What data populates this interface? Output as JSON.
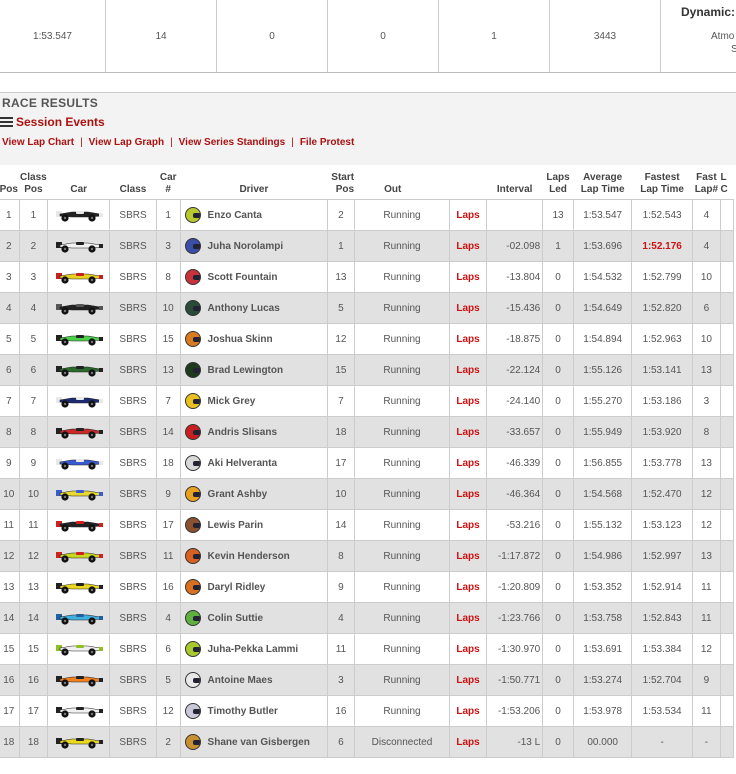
{
  "summary": {
    "cells": [
      "1:53.547",
      "14",
      "0",
      "0",
      "1",
      "3443"
    ],
    "dynamic_label": "Dynamic:",
    "atmo_label": "Atmo",
    "atmo_tail": "S"
  },
  "header": {
    "title": "RACE RESULTS",
    "session_events": "Session Events",
    "links": [
      "View Lap Chart",
      "View Lap Graph",
      "View Series Standings",
      "File Protest"
    ],
    "link_sep": "|"
  },
  "table": {
    "columns": {
      "pos": "Pos",
      "class_pos_1": "Class",
      "class_pos_2": "Pos",
      "car": "Car",
      "class": "Class",
      "car_num_1": "Car",
      "car_num_2": "#",
      "driver": "Driver",
      "start_1": "Start",
      "start_2": "Pos",
      "out": "Out",
      "interval": "Interval",
      "laps_led_1": "Laps",
      "laps_led_2": "Led",
      "avg_1": "Average",
      "avg_2": "Lap Time",
      "fast_1": "Fastest",
      "fast_2": "Lap Time",
      "fastlap_1": "Fast",
      "fastlap_2": "Lap#",
      "extra_1": "L",
      "extra_2": "C"
    },
    "laps_label": "Laps",
    "rows": [
      {
        "pos": "1",
        "class_pos": "1",
        "class": "SBRS",
        "car_num": "1",
        "driver": "Enzo Canta",
        "start": "2",
        "out": "Running",
        "interval": "",
        "laps_led": "13",
        "avg": "1:53.547",
        "fastest": "1:52.543",
        "fast_lap": "4",
        "car_color": "#222222",
        "car_accent": "#e8e8e8",
        "helmet": "#b8c830",
        "best": false
      },
      {
        "pos": "2",
        "class_pos": "2",
        "class": "SBRS",
        "car_num": "3",
        "driver": "Juha Norolampi",
        "start": "1",
        "out": "Running",
        "interval": "-02.098",
        "laps_led": "1",
        "avg": "1:53.696",
        "fastest": "1:52.176",
        "fast_lap": "4",
        "car_color": "#f2f2f2",
        "car_accent": "#222222",
        "helmet": "#3a4ea8",
        "best": true
      },
      {
        "pos": "3",
        "class_pos": "3",
        "class": "SBRS",
        "car_num": "8",
        "driver": "Scott Fountain",
        "start": "13",
        "out": "Running",
        "interval": "-13.804",
        "laps_led": "0",
        "avg": "1:54.532",
        "fastest": "1:52.799",
        "fast_lap": "10",
        "car_color": "#e8d020",
        "car_accent": "#c82020",
        "helmet": "#c8323a",
        "best": false
      },
      {
        "pos": "4",
        "class_pos": "4",
        "class": "SBRS",
        "car_num": "10",
        "driver": "Anthony Lucas",
        "start": "5",
        "out": "Running",
        "interval": "-15.436",
        "laps_led": "0",
        "avg": "1:54.649",
        "fastest": "1:52.820",
        "fast_lap": "6",
        "car_color": "#222222",
        "car_accent": "#555555",
        "helmet": "#2a4a3a",
        "best": false
      },
      {
        "pos": "5",
        "class_pos": "5",
        "class": "SBRS",
        "car_num": "15",
        "driver": "Joshua Skinn",
        "start": "12",
        "out": "Running",
        "interval": "-18.875",
        "laps_led": "0",
        "avg": "1:54.894",
        "fastest": "1:52.963",
        "fast_lap": "10",
        "car_color": "#4ad04a",
        "car_accent": "#222222",
        "helmet": "#d87a20",
        "best": false
      },
      {
        "pos": "6",
        "class_pos": "6",
        "class": "SBRS",
        "car_num": "13",
        "driver": "Brad Lewington",
        "start": "15",
        "out": "Running",
        "interval": "-22.124",
        "laps_led": "0",
        "avg": "1:55.126",
        "fastest": "1:53.141",
        "fast_lap": "13",
        "car_color": "#2a6a2a",
        "car_accent": "#222222",
        "helmet": "#1e3a1e",
        "best": false
      },
      {
        "pos": "7",
        "class_pos": "7",
        "class": "SBRS",
        "car_num": "7",
        "driver": "Mick Grey",
        "start": "7",
        "out": "Running",
        "interval": "-24.140",
        "laps_led": "0",
        "avg": "1:55.270",
        "fastest": "1:53.186",
        "fast_lap": "3",
        "car_color": "#1e2a70",
        "car_accent": "#e8e8e8",
        "helmet": "#e8c020",
        "best": false
      },
      {
        "pos": "8",
        "class_pos": "8",
        "class": "SBRS",
        "car_num": "14",
        "driver": "Andris Slisans",
        "start": "18",
        "out": "Running",
        "interval": "-33.657",
        "laps_led": "0",
        "avg": "1:55.949",
        "fastest": "1:53.920",
        "fast_lap": "8",
        "car_color": "#c82a2a",
        "car_accent": "#222222",
        "helmet": "#c82020",
        "best": false
      },
      {
        "pos": "9",
        "class_pos": "9",
        "class": "SBRS",
        "car_num": "18",
        "driver": "Aki Helveranta",
        "start": "17",
        "out": "Running",
        "interval": "-46.339",
        "laps_led": "0",
        "avg": "1:56.855",
        "fastest": "1:53.778",
        "fast_lap": "13",
        "car_color": "#3a5ad0",
        "car_accent": "#e8e8e8",
        "helmet": "#d8d8d8",
        "best": false
      },
      {
        "pos": "10",
        "class_pos": "10",
        "class": "SBRS",
        "car_num": "9",
        "driver": "Grant Ashby",
        "start": "10",
        "out": "Running",
        "interval": "-46.364",
        "laps_led": "0",
        "avg": "1:54.568",
        "fastest": "1:52.470",
        "fast_lap": "12",
        "car_color": "#e8d830",
        "car_accent": "#3a5ad0",
        "helmet": "#e8a020",
        "best": false
      },
      {
        "pos": "11",
        "class_pos": "11",
        "class": "SBRS",
        "car_num": "17",
        "driver": "Lewis Parin",
        "start": "14",
        "out": "Running",
        "interval": "-53.216",
        "laps_led": "0",
        "avg": "1:55.132",
        "fastest": "1:53.123",
        "fast_lap": "12",
        "car_color": "#222222",
        "car_accent": "#d02020",
        "helmet": "#8a5030",
        "best": false
      },
      {
        "pos": "12",
        "class_pos": "12",
        "class": "SBRS",
        "car_num": "11",
        "driver": "Kevin Henderson",
        "start": "8",
        "out": "Running",
        "interval": "-1:17.872",
        "laps_led": "0",
        "avg": "1:54.986",
        "fastest": "1:52.997",
        "fast_lap": "13",
        "car_color": "#c8d820",
        "car_accent": "#d02020",
        "helmet": "#d86020",
        "best": false
      },
      {
        "pos": "13",
        "class_pos": "13",
        "class": "SBRS",
        "car_num": "16",
        "driver": "Daryl Ridley",
        "start": "9",
        "out": "Running",
        "interval": "-1:20.809",
        "laps_led": "0",
        "avg": "1:53.352",
        "fastest": "1:52.914",
        "fast_lap": "11",
        "car_color": "#e8d820",
        "car_accent": "#222222",
        "helmet": "#d87020",
        "best": false
      },
      {
        "pos": "14",
        "class_pos": "14",
        "class": "SBRS",
        "car_num": "4",
        "driver": "Colin Suttie",
        "start": "4",
        "out": "Running",
        "interval": "-1:23.766",
        "laps_led": "0",
        "avg": "1:53.758",
        "fastest": "1:52.843",
        "fast_lap": "11",
        "car_color": "#40b0e0",
        "car_accent": "#2060a0",
        "helmet": "#60b040",
        "best": false
      },
      {
        "pos": "15",
        "class_pos": "15",
        "class": "SBRS",
        "car_num": "6",
        "driver": "Juha-Pekka Lammi",
        "start": "11",
        "out": "Running",
        "interval": "-1:30.970",
        "laps_led": "0",
        "avg": "1:53.691",
        "fastest": "1:53.384",
        "fast_lap": "12",
        "car_color": "#f0f0f0",
        "car_accent": "#90c020",
        "helmet": "#a8c830",
        "best": false
      },
      {
        "pos": "16",
        "class_pos": "16",
        "class": "SBRS",
        "car_num": "5",
        "driver": "Antoine Maes",
        "start": "3",
        "out": "Running",
        "interval": "-1:50.771",
        "laps_led": "0",
        "avg": "1:53.274",
        "fastest": "1:52.704",
        "fast_lap": "9",
        "car_color": "#f08020",
        "car_accent": "#222222",
        "helmet": "#e8e8e8",
        "best": false
      },
      {
        "pos": "17",
        "class_pos": "17",
        "class": "SBRS",
        "car_num": "12",
        "driver": "Timothy Butler",
        "start": "16",
        "out": "Running",
        "interval": "-1:53.206",
        "laps_led": "0",
        "avg": "1:53.978",
        "fastest": "1:53.534",
        "fast_lap": "11",
        "car_color": "#f0f0f0",
        "car_accent": "#222222",
        "helmet": "#c8c8d8",
        "best": false
      },
      {
        "pos": "18",
        "class_pos": "18",
        "class": "SBRS",
        "car_num": "2",
        "driver": "Shane van Gisbergen",
        "start": "6",
        "out": "Disconnected",
        "interval": "-13 L",
        "laps_led": "0",
        "avg": "00.000",
        "fastest": "-",
        "fast_lap": "-",
        "car_color": "#e8d820",
        "car_accent": "#222222",
        "helmet": "#c89030",
        "best": false
      }
    ]
  }
}
